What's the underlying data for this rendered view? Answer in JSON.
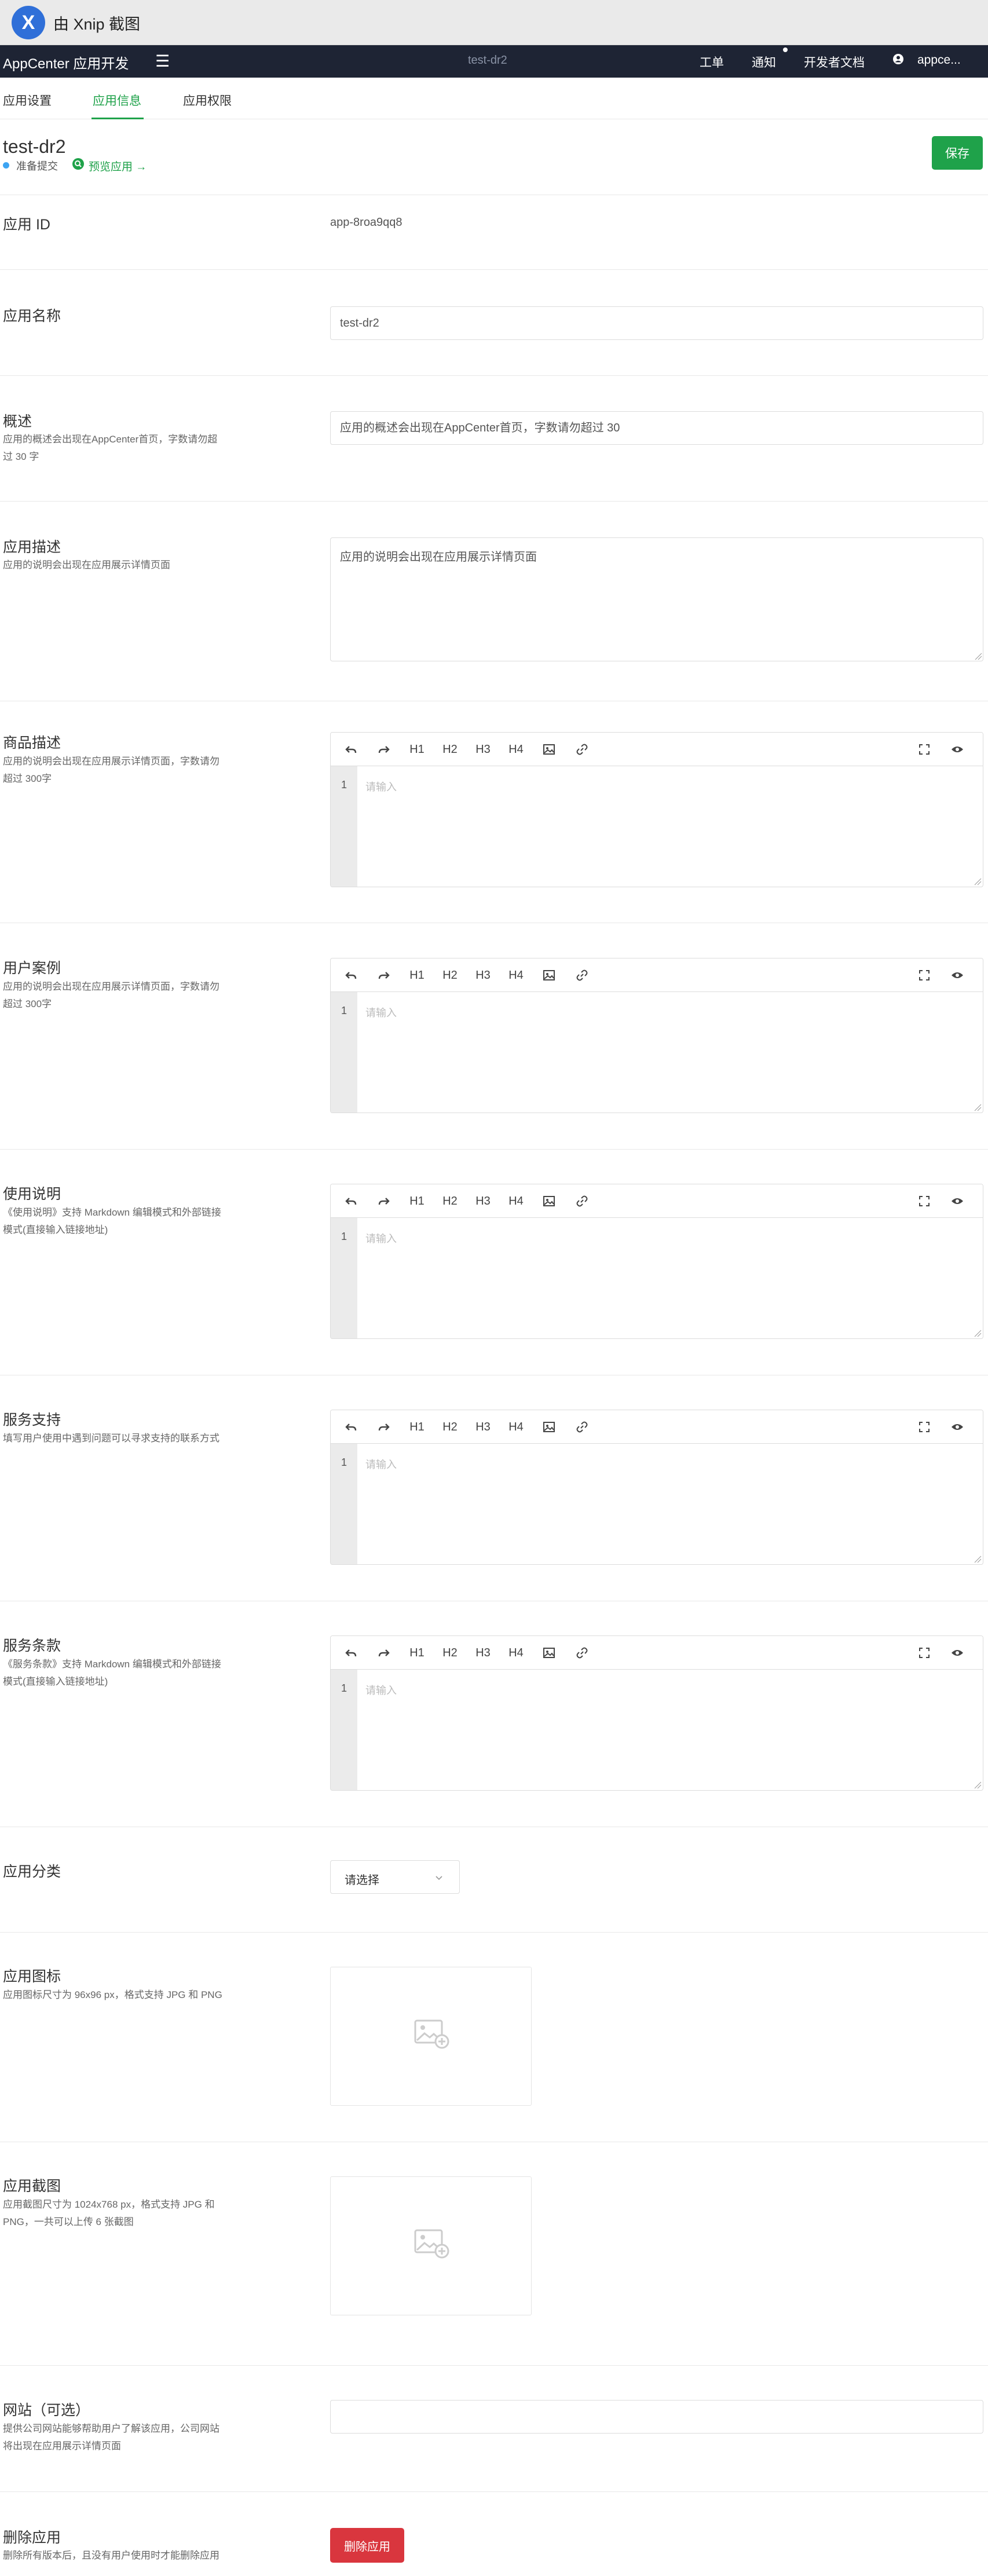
{
  "xnip": {
    "title": "由 Xnip 截图",
    "logo": "X"
  },
  "topnav": {
    "brand": "AppCenter 应用开发",
    "env_title": "test-dr2",
    "items": [
      "工单",
      "通知",
      "开发者文档"
    ],
    "user": "appce..."
  },
  "tabs": [
    {
      "label": "应用设置",
      "active": false
    },
    {
      "label": "应用信息",
      "active": true
    },
    {
      "label": "应用权限",
      "active": false
    }
  ],
  "header": {
    "app_title": "test-dr2",
    "status": "准备提交",
    "preview_link": "预览应用 →",
    "save_label": "保存"
  },
  "fields": {
    "app_id": {
      "label": "应用 ID",
      "value": "app-8roa9qq8"
    },
    "app_name": {
      "label": "应用名称",
      "value": "test-dr2"
    },
    "summary": {
      "label": "概述",
      "desc": "应用的概述会出现在AppCenter首页，字数请勿超过 30 字",
      "value": "应用的概述会出现在AppCenter首页，字数请勿超过 30"
    },
    "description": {
      "label": "应用描述",
      "desc": "应用的说明会出现在应用展示详情页面",
      "value": "应用的说明会出现在应用展示详情页面"
    },
    "product_desc": {
      "label": "商品描述",
      "desc": "应用的说明会出现在应用展示详情页面，字数请勿超过 300字"
    },
    "user_cases": {
      "label": "用户案例",
      "desc": "应用的说明会出现在应用展示详情页面，字数请勿超过 300字"
    },
    "usage": {
      "label": "使用说明",
      "desc": "《使用说明》支持 Markdown 编辑模式和外部链接模式(直接输入链接地址)"
    },
    "support": {
      "label": "服务支持",
      "desc": "填写用户使用中遇到问题可以寻求支持的联系方式"
    },
    "terms": {
      "label": "服务条款",
      "desc": "《服务条款》支持 Markdown 编辑模式和外部链接模式(直接输入链接地址)"
    },
    "category": {
      "label": "应用分类",
      "selected": "请选择"
    },
    "icon": {
      "label": "应用图标",
      "desc": "应用图标尺寸为 96x96 px，格式支持 JPG 和 PNG"
    },
    "screenshots": {
      "label": "应用截图",
      "desc": "应用截图尺寸为 1024x768 px，格式支持 JPG 和 PNG，一共可以上传 6 张截图"
    },
    "website": {
      "label": "网站（可选）",
      "desc": "提供公司网站能够帮助用户了解该应用，公司网站将出现在应用展示详情页面",
      "value": ""
    },
    "delete": {
      "label": "删除应用",
      "desc": "删除所有版本后，且没有用户使用时才能删除应用",
      "button": "删除应用"
    }
  },
  "editor": {
    "toolbar": [
      "undo-icon",
      "redo-icon",
      "H1",
      "H2",
      "H3",
      "H4",
      "image-icon",
      "link-icon",
      "fullscreen-icon",
      "preview-icon",
      "split-view-icon"
    ],
    "h1": "H1",
    "h2": "H2",
    "h3": "H3",
    "h4": "H4",
    "line_number": "1",
    "placeholder": "请输入"
  },
  "colors": {
    "accent": "#1fa24a",
    "nav_bg": "#1e2434",
    "danger": "#d9363e",
    "status_dot": "#3da4f2"
  }
}
